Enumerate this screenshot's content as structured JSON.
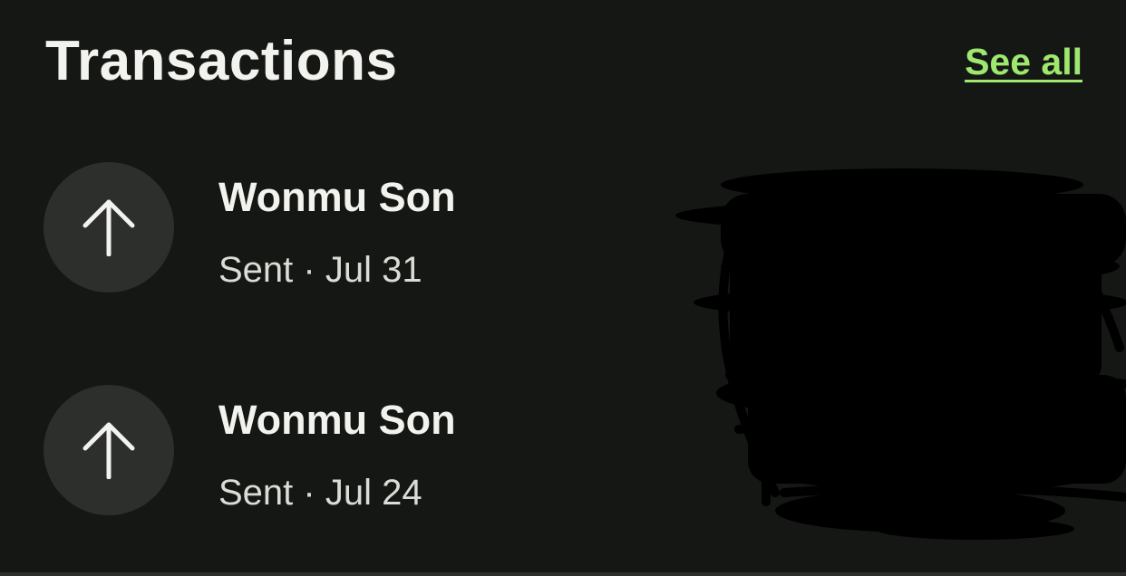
{
  "header": {
    "title": "Transactions",
    "see_all_label": "See all"
  },
  "transactions": [
    {
      "name": "Wonmu Son",
      "status": "Sent",
      "date": "Jul 31",
      "meta": "Sent · Jul 31",
      "icon": "arrow-up-icon"
    },
    {
      "name": "Wonmu Son",
      "status": "Sent",
      "date": "Jul 24",
      "meta": "Sent · Jul 24",
      "icon": "arrow-up-icon"
    }
  ],
  "colors": {
    "background": "#151714",
    "accent": "#9fe870",
    "icon_circle": "#2d2f2c",
    "text_primary": "#f2f2ee",
    "redaction": "#000000"
  }
}
